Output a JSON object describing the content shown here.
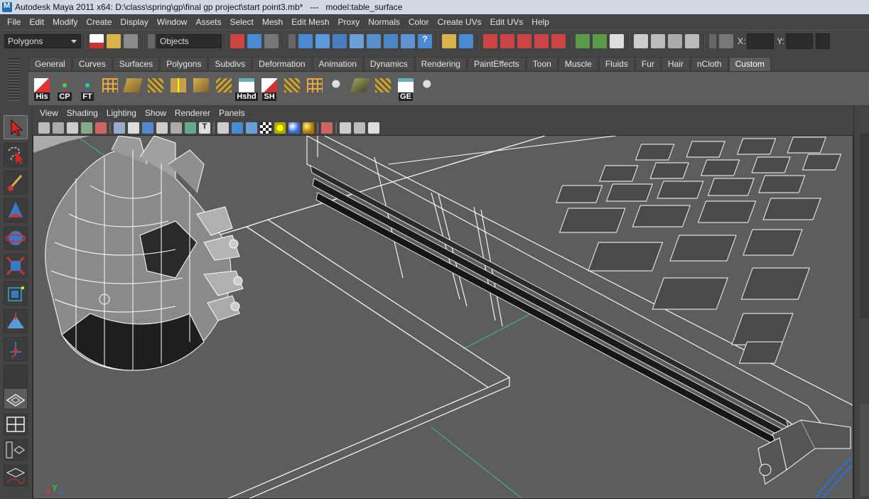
{
  "window": {
    "title": "Autodesk Maya 2011 x64: D:\\class\\spring\\gp\\final gp project\\start point3.mb*   ---   model:table_surface"
  },
  "menubar": {
    "items": [
      "File",
      "Edit",
      "Modify",
      "Create",
      "Display",
      "Window",
      "Assets",
      "Select",
      "Mesh",
      "Edit Mesh",
      "Proxy",
      "Normals",
      "Color",
      "Create UVs",
      "Edit UVs",
      "Help"
    ]
  },
  "statusline": {
    "menuset": "Polygons",
    "selection_mode": "Objects",
    "x_label": "X:",
    "y_label": "Y:"
  },
  "shelf": {
    "tabs": [
      "General",
      "Curves",
      "Surfaces",
      "Polygons",
      "Subdivs",
      "Deformation",
      "Animation",
      "Dynamics",
      "Rendering",
      "PaintEffects",
      "Toon",
      "Muscle",
      "Fluids",
      "Fur",
      "Hair",
      "nCloth",
      "Custom"
    ],
    "active_tab": "Custom",
    "buttons": [
      {
        "label": "His",
        "icon": "history-icon"
      },
      {
        "label": "CP",
        "icon": "center-pivot-icon"
      },
      {
        "label": "FT",
        "icon": "freeze-transform-icon"
      },
      {
        "label": "",
        "icon": "poly-grid-delete-icon"
      },
      {
        "label": "",
        "icon": "poly-select-icon"
      },
      {
        "label": "",
        "icon": "poly-grid-icon"
      },
      {
        "label": "",
        "icon": "poly-split-icon"
      },
      {
        "label": "",
        "icon": "poly-extrude-icon"
      },
      {
        "label": "",
        "icon": "poly-merge-icon"
      },
      {
        "label": "Hshd",
        "icon": "hypershade-icon"
      },
      {
        "label": "SH",
        "icon": "script-editor-icon"
      },
      {
        "label": "",
        "icon": "poly-select-icon"
      },
      {
        "label": "",
        "icon": "poly-grid-delete-icon"
      },
      {
        "label": "",
        "icon": "script-icon"
      },
      {
        "label": "",
        "icon": "poly-plane-icon"
      },
      {
        "label": "",
        "icon": "poly-smooth-icon"
      },
      {
        "label": "GE",
        "icon": "graph-editor-icon"
      },
      {
        "label": "",
        "icon": "script-icon"
      }
    ]
  },
  "panel": {
    "menu": [
      "View",
      "Shading",
      "Lighting",
      "Show",
      "Renderer",
      "Panels"
    ]
  },
  "viewport": {
    "axis_x": "x",
    "axis_y": "y",
    "axis_z": "z"
  },
  "colors": {
    "viewport_bg": "#5d5d5d",
    "wire": "#ffffff",
    "grid_axis": "#3dbf8a",
    "accent_red": "#c0392b",
    "accent_blue": "#2f72c4"
  }
}
